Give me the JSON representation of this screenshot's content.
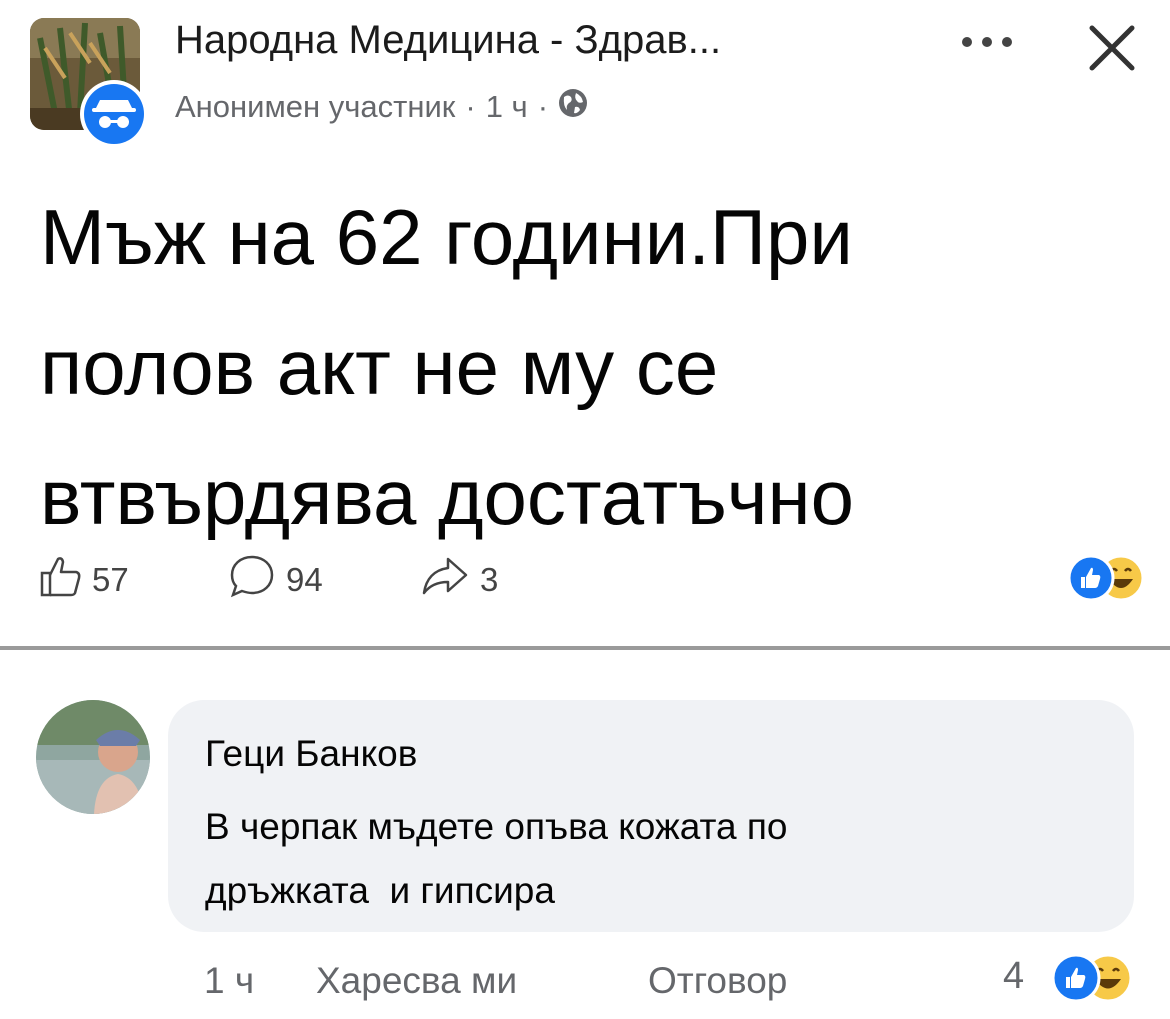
{
  "header": {
    "group_name": "Народна Медицина - Здрав...",
    "author": "Анонимен участник",
    "time": "1 ч",
    "separator": "·",
    "icons": [
      "group-avatar",
      "anonymous-icon",
      "globe-icon",
      "more-icon",
      "close-icon"
    ]
  },
  "post": {
    "lines": [
      "Мъж на 62 години.При",
      "полов акт не му се",
      "втвърдява достатъчно"
    ],
    "actions": {
      "likes": "57",
      "comments": "94",
      "shares": "3"
    },
    "reactions": [
      "like",
      "haha"
    ]
  },
  "comment": {
    "author": "Геци Банков",
    "lines": [
      "В черпак мъдете опъва кожата по",
      "дръжката  и гипсира"
    ],
    "time": "1 ч",
    "like_label": "Харесва ми",
    "reply_label": "Отговор",
    "reaction_count": "4",
    "reactions": [
      "like",
      "haha"
    ]
  },
  "colors": {
    "like_blue": "#1877f2",
    "haha_yellow": "#f7c948",
    "bubble_bg": "#f0f2f5",
    "meta_gray": "#65676b"
  }
}
